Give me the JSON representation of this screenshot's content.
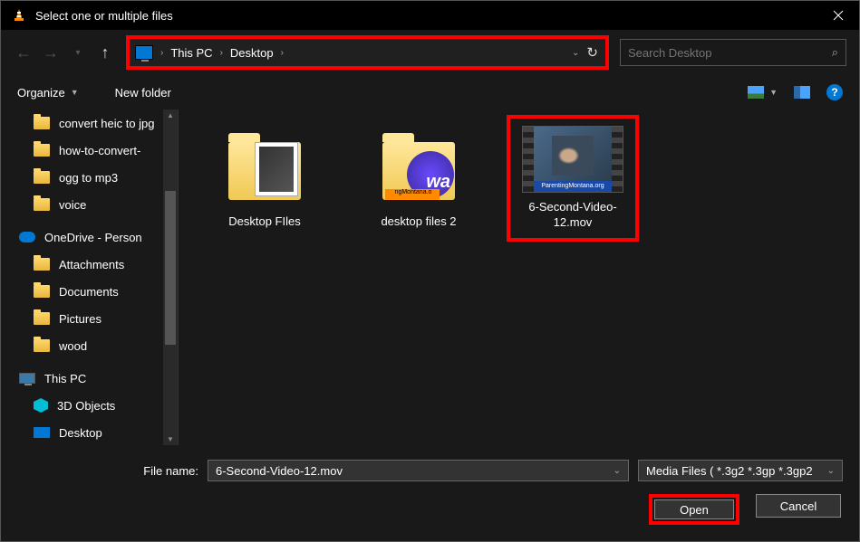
{
  "title": "Select one or multiple files",
  "breadcrumb": {
    "pc": "This PC",
    "loc": "Desktop"
  },
  "search": {
    "placeholder": "Search Desktop"
  },
  "toolbar": {
    "organize": "Organize",
    "newfolder": "New folder"
  },
  "sidebar": {
    "items": [
      {
        "label": "convert heic to jpg",
        "icon": "folder"
      },
      {
        "label": "how-to-convert-",
        "icon": "folder"
      },
      {
        "label": "ogg to mp3",
        "icon": "folder"
      },
      {
        "label": "voice",
        "icon": "folder"
      }
    ],
    "onedrive": "OneDrive - Person",
    "onedrive_items": [
      {
        "label": "Attachments"
      },
      {
        "label": "Documents"
      },
      {
        "label": "Pictures"
      },
      {
        "label": "wood"
      }
    ],
    "thispc": "This PC",
    "thispc_items": [
      {
        "label": "3D Objects",
        "icon": "obj3d"
      },
      {
        "label": "Desktop",
        "icon": "desk"
      }
    ]
  },
  "files": {
    "folder1": "Desktop FIles",
    "folder2": "desktop files 2",
    "folder2_strip": "ngMontana.o",
    "video": "6-Second-Video-12.mov",
    "video_banner": "ParentingMontana.org"
  },
  "footer": {
    "filename_label": "File name:",
    "filename_value": "6-Second-Video-12.mov",
    "filter": "Media Files ( *.3g2 *.3gp *.3gp2",
    "open": "Open",
    "cancel": "Cancel"
  },
  "help": "?"
}
